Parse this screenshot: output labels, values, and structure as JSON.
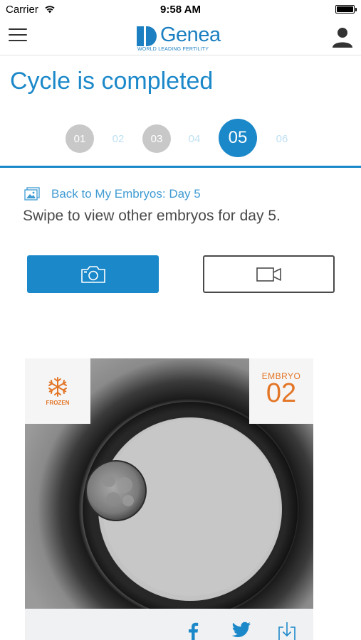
{
  "status_bar": {
    "carrier": "Carrier",
    "time": "9:58 AM"
  },
  "header": {
    "logo_name": "Genea",
    "logo_tagline": "WORLD LEADING FERTILITY",
    "menu_icon": "hamburger-menu-icon",
    "profile_icon": "user-profile-icon"
  },
  "page": {
    "title": "Cycle is completed"
  },
  "stepper": {
    "steps": [
      {
        "label": "01",
        "state": "done"
      },
      {
        "label": "02",
        "state": "plain"
      },
      {
        "label": "03",
        "state": "done"
      },
      {
        "label": "04",
        "state": "plain"
      },
      {
        "label": "05",
        "state": "active"
      },
      {
        "label": "06",
        "state": "plain"
      }
    ]
  },
  "embryo_nav": {
    "back_label": "Back to My Embryos: Day 5",
    "swipe_hint": "Swipe to view other embryos for day 5."
  },
  "media_toggle": {
    "photo_icon": "camera-icon",
    "video_icon": "video-camera-icon"
  },
  "embryo_card": {
    "status_label": "FROZEN",
    "embryo_label": "EMBRYO",
    "embryo_number": "02",
    "share_icons": [
      "facebook-icon",
      "twitter-icon",
      "download-icon"
    ]
  },
  "colors": {
    "brand_blue": "#1b88c9",
    "accent_orange": "#e37526",
    "step_done_grey": "#c8c8c8"
  }
}
